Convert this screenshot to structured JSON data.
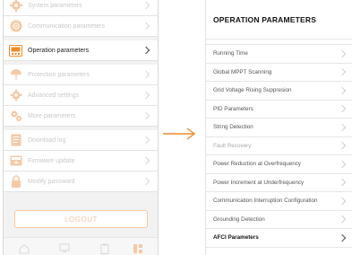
{
  "left": {
    "menu": [
      {
        "label": "System parameters",
        "icon": "gear-icon"
      },
      {
        "label": "Communication parameters",
        "icon": "communication-icon"
      },
      {
        "label": "Operation parameters",
        "icon": "meter-icon"
      },
      {
        "label": "Protection parameters",
        "icon": "umbrella-icon"
      },
      {
        "label": "Advanced settings",
        "icon": "gear-icon"
      },
      {
        "label": "More parameters",
        "icon": "gears-icon"
      },
      {
        "label": "Download log",
        "icon": "document-icon"
      },
      {
        "label": "Firmware update",
        "icon": "firmware-icon"
      },
      {
        "label": "Modify password",
        "icon": "lock-icon"
      }
    ],
    "logout_label": "LOGOUT"
  },
  "right": {
    "title": "OPERATION PARAMETERS",
    "items": [
      "Running Time",
      "Global MPPT Scanning",
      "Grid Voltage Rising Suppresion",
      "PID Parameters",
      "String Detection",
      "Fault Recovery",
      "Power Reduction at Overfrequency",
      "Power Increment at Underfrequency",
      "Communication Interruption Configuration",
      "Grounding Detection",
      "AFCI Parameters"
    ]
  },
  "colors": {
    "accent": "#f08a2a",
    "icon_faded": "#f5c9a6",
    "text_faded": "#c9c9c9"
  }
}
